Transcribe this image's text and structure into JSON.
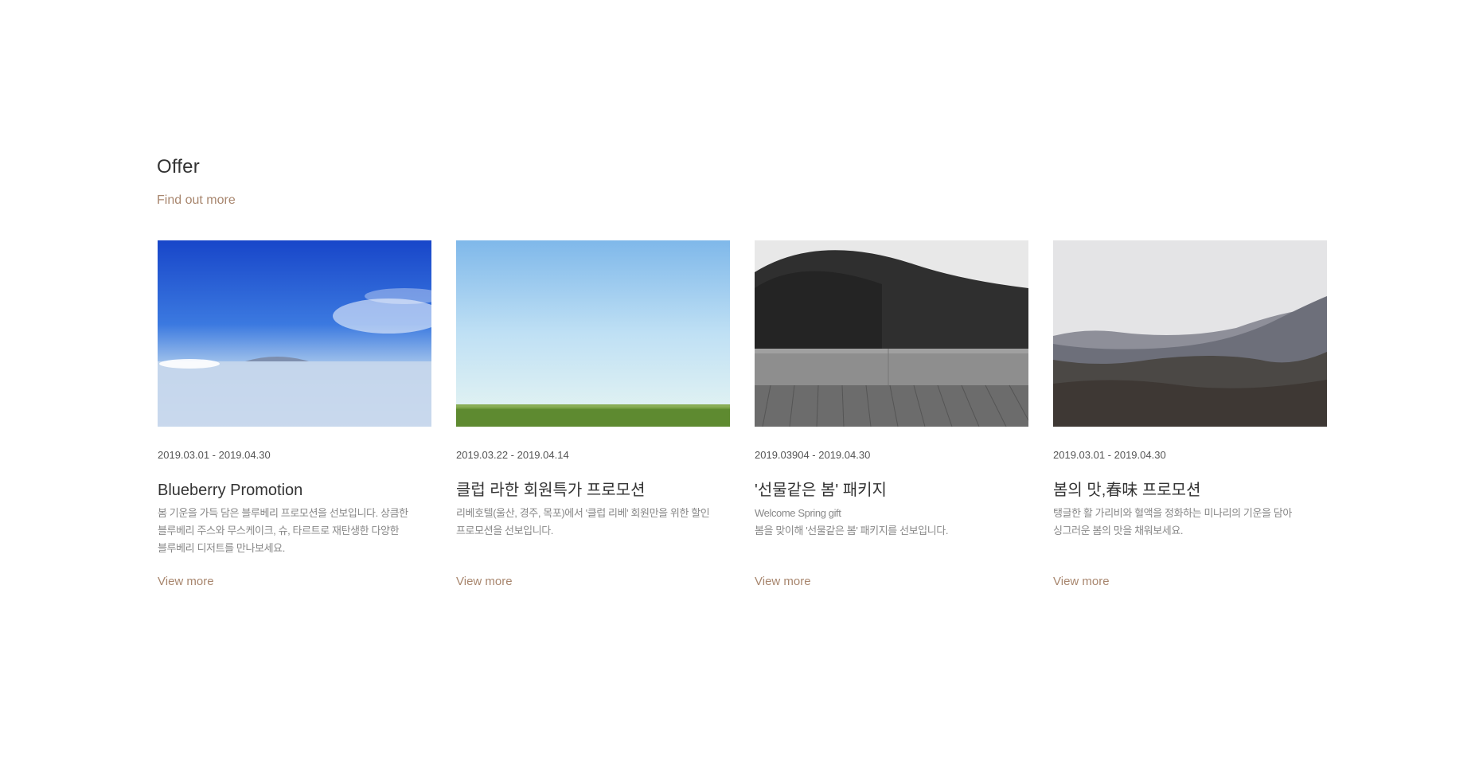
{
  "section": {
    "title": "Offer",
    "find_more": "Find out more"
  },
  "cards": [
    {
      "date": "2019.03.01 - 2019.04.30",
      "title": "Blueberry Promotion",
      "desc": [
        "봄 기운을 가득 담은 블루베리 프로모션을 선보입니다. 상큼한",
        "블루베리 주스와 무스케이크, 슈, 타르트로 재탄생한 다양한",
        "블루베리 디저트를 만나보세요."
      ],
      "link": "View more"
    },
    {
      "date": "2019.03.22 - 2019.04.14",
      "title": "클럽 라한 회원특가 프로모션",
      "desc": [
        "리베호텔(울산, 경주, 목포)에서 '클럽 리베' 회원만을 위한 할인",
        "프로모션을 선보입니다."
      ],
      "link": "View more"
    },
    {
      "date": "2019.03904 - 2019.04.30",
      "title": "'선물같은 봄' 패키지",
      "desc": [
        "Welcome Spring gift",
        "봄을 맞이해 '선물같은 봄' 패키지를 선보입니다."
      ],
      "link": "View more"
    },
    {
      "date": "2019.03.01 - 2019.04.30",
      "title": "봄의 맛,春味 프로모션",
      "desc": [
        "탱글한 활 가리비와 혈액을 정화하는 미나리의 기운을 담아",
        "싱그러운 봄의 맛을 채워보세요."
      ],
      "link": "View more"
    }
  ]
}
